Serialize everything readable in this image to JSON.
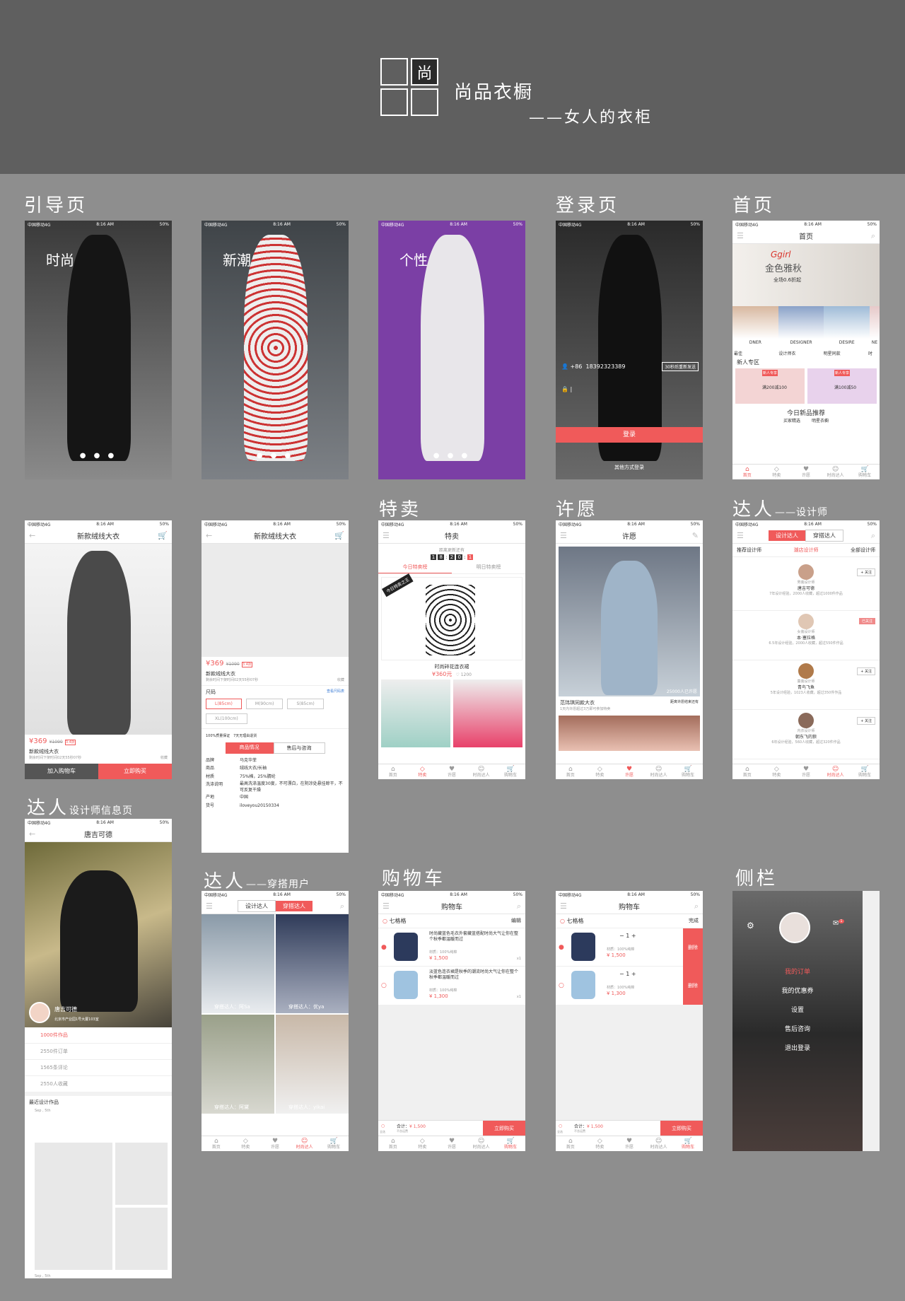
{
  "header": {
    "logo_char": "尚",
    "brand": "尚品衣橱",
    "tagline": "——女人的衣柜"
  },
  "sections": {
    "guide": "引导页",
    "login": "登录页",
    "home": "首页",
    "sale": "特卖",
    "wish": "许愿",
    "designer": "达人",
    "designer_sub": "——设计师",
    "designer_info": "达人",
    "designer_info_sub": "设计师信息页",
    "outfit": "达人",
    "outfit_sub": "——穿搭用户",
    "cart": "购物车",
    "side": "侧栏"
  },
  "status": {
    "carrier": "中国移动4G",
    "time": "8:16 AM",
    "battery": "50%"
  },
  "guide": {
    "words": [
      "时尚",
      "新潮",
      "个性"
    ],
    "dots": "● ● ●"
  },
  "login": {
    "cc": "+86",
    "phone": "18392323389",
    "code_btn": "30秒后重新发送",
    "login_btn": "登录",
    "other": "其他方式登录"
  },
  "home": {
    "title": "首页",
    "banner_brand": "Ggirl",
    "banner_title": "金色雅秋",
    "banner_sub": "全场0.6折起",
    "brands": [
      "DNER",
      "DESIGNER",
      "DESIRE",
      "NE"
    ],
    "brand_labels": [
      "最佳",
      "设计师衣",
      "明星同款",
      "时"
    ],
    "new_zone": "新人专区",
    "promo1": "新人专享",
    "promo1_price": "满200减100",
    "promo2": "新人专享",
    "promo2_price": "满100减50",
    "today_new": "今日新品推荐",
    "tag1": "买家精选",
    "tag2": "明星衣橱"
  },
  "tabs": [
    "首页",
    "特卖",
    "许愿",
    "时尚达人",
    "购物车"
  ],
  "detail": {
    "title": "新款绒线大衣",
    "price": "¥369",
    "old_price": "¥1090",
    "discount": "3.4折",
    "name": "新款绒线大衣",
    "countdown": "剩余时间下架时间02天55秒07秒",
    "fav": "收藏",
    "add_cart": "加入购物车",
    "buy_now": "立即购买",
    "size_label": "尺码",
    "size_chart": "查看尺码表",
    "sizes": [
      "L(85cm)",
      "M(90cm)",
      "S(85cm)",
      "XL(100cm)"
    ],
    "guarantee1": "100%质量保证",
    "guarantee2": "7天无理由退货",
    "tab_info": "商品情况",
    "tab_after": "售后与咨询",
    "specs": [
      {
        "k": "品牌",
        "v": "马克华菲"
      },
      {
        "k": "商品",
        "v": "绒线大衣/长袖"
      },
      {
        "k": "材质",
        "v": "75%棉，25%腈纶"
      },
      {
        "k": "洗涤说明",
        "v": "最高洗涤温度30度，不可漂白，在阴凉处悬挂晾干，不可反复干燥"
      },
      {
        "k": "产地",
        "v": "中国"
      },
      {
        "k": "货号",
        "v": "iloveyou20150334"
      }
    ]
  },
  "sale": {
    "title": "特卖",
    "next": "距离更新还有",
    "clock": [
      "1",
      "8",
      "2",
      "0",
      "1"
    ],
    "tab_today": "今日特卖榜",
    "tab_tomorrow": "明日特卖榜",
    "badge": "今日特卖之王",
    "item": "时尚碎花连衣裙",
    "price": "¥360元",
    "likes": "1200"
  },
  "wish": {
    "title": "许愿",
    "joined": "25000人已许愿",
    "item": "范玮琪同款大衣",
    "deadline": "距离许愿结束还有",
    "desc": "1天内许愿超过3万即可参加特卖"
  },
  "designer": {
    "tab1": "设计达人",
    "tab2": "穿搭达人",
    "sub_tabs": [
      "推荐设计师",
      "潮店设计师",
      "全部设计师"
    ],
    "list": [
      {
        "role": "男装设计师",
        "name": "唐吉可德",
        "stat": "7年设计经验，2000人收藏，超过1000件作品",
        "btn": "+ 关注"
      },
      {
        "role": "女装设计师",
        "name": "本·塞拉格",
        "stat": "6.5年设计经验，2000人收藏，超过550件作品",
        "btn": "已关注"
      },
      {
        "role": "童装设计师",
        "name": "青鸟飞鱼",
        "stat": "5年设计经验，1023人收藏，超过350件作品",
        "btn": "+ 关注"
      },
      {
        "role": "内衣设计师",
        "name": "朝东飞的狼",
        "stat": "6年设计经验，560人收藏，超过320件作品",
        "btn": "+ 关注"
      }
    ]
  },
  "profile": {
    "title": "唐吉可德",
    "name": "唐吉可德",
    "addr": "北京市产业园1号大厦103室",
    "stats": [
      "1000件作品",
      "2550件订单",
      "1565条评论",
      "2550人收藏"
    ],
    "recent": "最近设计作品",
    "date": "Sep , 5th",
    "date2": "Sep , 5th"
  },
  "outfit": {
    "tab1": "设计达人",
    "tab2": "穿搭达人",
    "users": [
      "穿搭达人：阿Sa",
      "穿搭达人：优ya",
      "穿搭达人：阿黛",
      "穿搭达人：yikai"
    ]
  },
  "cart": {
    "title": "购物车",
    "shop": "七格格",
    "edit": "编辑",
    "done": "完成",
    "items": [
      {
        "desc": "时尚藏蓝色毛衣外套藏蓝搭配时尚大气让你在整个秋季都温暖而过",
        "mat": "材质：100%纯棉",
        "price": "¥ 1,500",
        "qty": "x1"
      },
      {
        "desc": "淡蓝色连衣裙是秋季的潮流时尚大气让你在整个秋季都温暖而过",
        "mat": "材质：100%纯棉",
        "price": "¥ 1,300",
        "qty": "x1"
      }
    ],
    "qty_val": "1",
    "delete": "删除",
    "all": "全选",
    "total": "合计：",
    "total_val": "¥ 1,500",
    "freight": "不含运费",
    "buy": "立即购买"
  },
  "side": {
    "menu": [
      "我的订单",
      "我的优惠券",
      "设置",
      "售后咨询",
      "退出登录"
    ],
    "badge": "1"
  }
}
